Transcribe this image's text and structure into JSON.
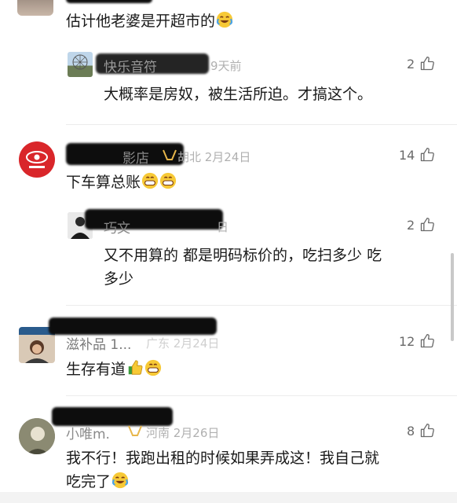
{
  "comments": [
    {
      "id": "c0",
      "text": "估计他老婆是开超市的",
      "emoji": "laughing-tears"
    },
    {
      "id": "c0r1",
      "name": "快乐音符",
      "meta": "9天前",
      "likes": "2",
      "text": "大概率是房奴，被生活所迫。才搞这个。"
    },
    {
      "id": "c1",
      "name": "影店",
      "region": "湖北",
      "date": "2月24日",
      "meta_tail": "胡北 2月24日",
      "likes": "14",
      "text": "下车算总账",
      "emojis": [
        "grinning",
        "grinning"
      ]
    },
    {
      "id": "c1r1",
      "name": "巧文",
      "meta": "日",
      "likes": "2",
      "text_line1": "又不用算的 都是明码标价的，吃扫多少 吃",
      "text_line2": "多少"
    },
    {
      "id": "c2",
      "name": "滋补品 1...",
      "meta": "广东 2月24日",
      "likes": "12",
      "text": "生存有道",
      "emojis": [
        "thumbs-up",
        "grinning"
      ]
    },
    {
      "id": "c3",
      "name": "小唯m.",
      "meta": "河南 2月26日",
      "likes": "8",
      "text_line1": "我不行！我跑出租的时候如果弄成这！我自己就",
      "text_line2": "吃完了",
      "emoji": "laughing-tears"
    }
  ]
}
